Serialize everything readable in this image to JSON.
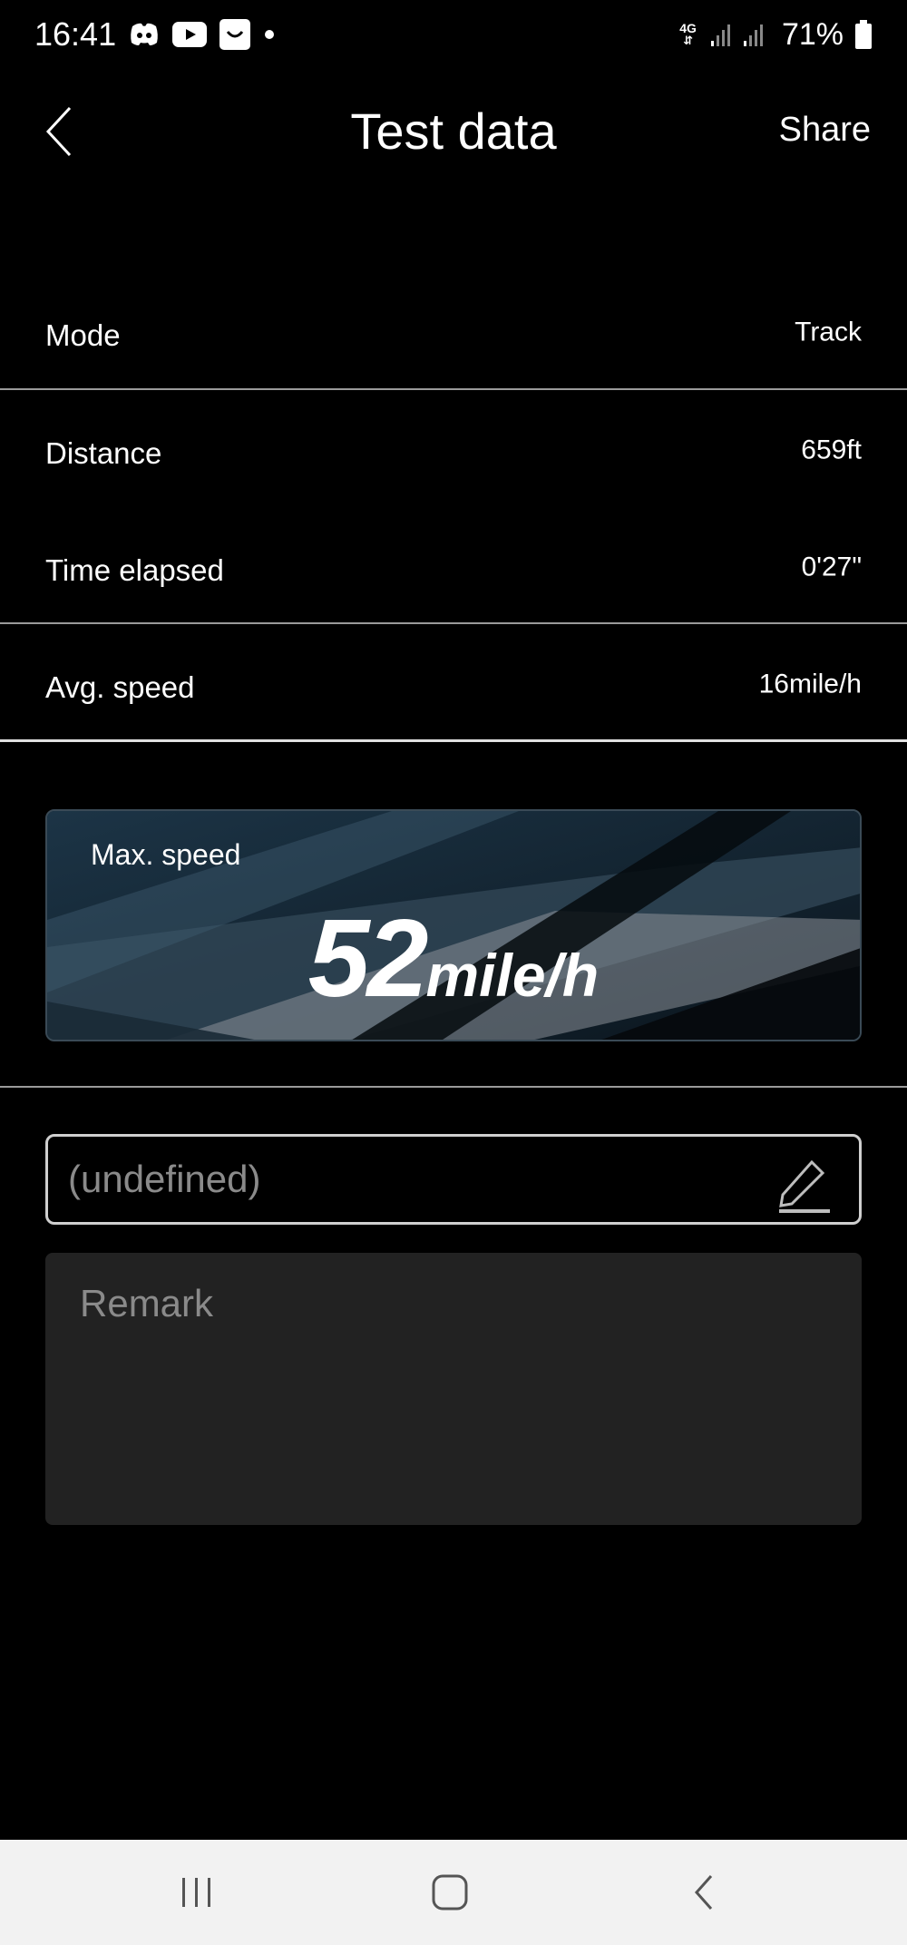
{
  "status_bar": {
    "time": "16:41",
    "network": "4G",
    "battery": "71%",
    "icons": [
      "discord-icon",
      "youtube-icon",
      "shop-icon",
      "dot-icon",
      "signal-icon",
      "battery-icon"
    ]
  },
  "header": {
    "title": "Test data",
    "share_label": "Share"
  },
  "rows": [
    {
      "label": "Mode",
      "value": "Track"
    },
    {
      "label": "Distance",
      "value": "659ft"
    },
    {
      "label": "Time elapsed",
      "value": "0'27\""
    },
    {
      "label": "Avg. speed",
      "value": "16mile/h"
    }
  ],
  "max_speed": {
    "label": "Max. speed",
    "value": "52",
    "unit": "mile/h"
  },
  "name_field": {
    "placeholder": "(undefined)"
  },
  "remark": {
    "placeholder": "Remark"
  },
  "colors": {
    "background": "#000000",
    "card": "#0d1a24",
    "remark_bg": "#222222",
    "nav_bar": "#f2f2f2"
  }
}
